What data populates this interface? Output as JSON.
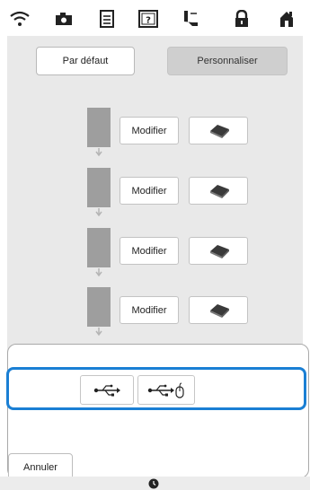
{
  "topbar": {
    "icons": [
      "wifi-icon",
      "camera-icon",
      "document-icon",
      "help-icon",
      "embroidery-frame-icon",
      "lock-icon",
      "home-icon"
    ]
  },
  "mode": {
    "default_label": "Par défaut",
    "custom_label": "Personnaliser",
    "selected": "Personnaliser"
  },
  "steps": [
    {
      "modify_label": "Modifier",
      "icon": "eraser-icon"
    },
    {
      "modify_label": "Modifier",
      "icon": "eraser-icon"
    },
    {
      "modify_label": "Modifier",
      "icon": "eraser-icon"
    },
    {
      "modify_label": "Modifier",
      "icon": "eraser-icon"
    }
  ],
  "popup": {
    "usb_buttons": [
      "usb-icon",
      "usb-mouse-icon"
    ],
    "cancel_label": "Annuler"
  },
  "bottombar": {
    "icon": "clock-icon"
  },
  "colors": {
    "highlight": "#1a7fd4",
    "panel": "#e9e9e9",
    "swatch": "#9e9e9e"
  }
}
